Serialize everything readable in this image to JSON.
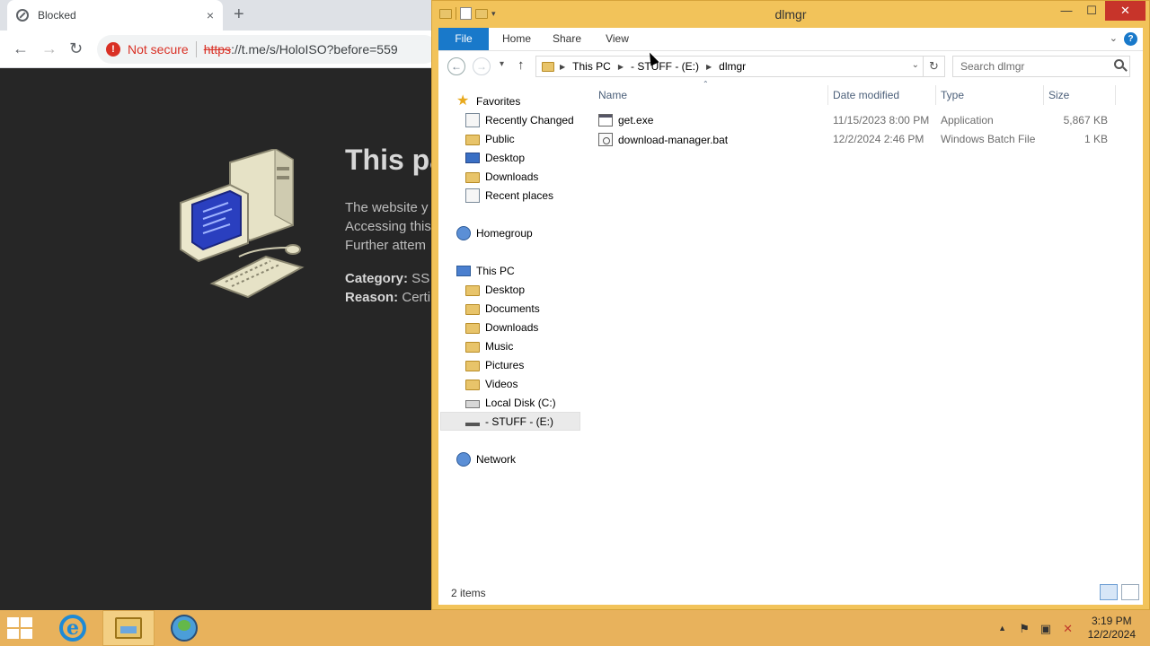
{
  "browser": {
    "tab_title": "Blocked",
    "tab_close": "×",
    "new_tab": "+",
    "nav_back": "←",
    "nav_forward": "→",
    "nav_reload": "↻",
    "security_icon": "!",
    "security_label": "Not secure",
    "url_scheme": "https",
    "url_rest": "://t.me/s/HoloISO?before=559"
  },
  "blocked_page": {
    "title": "This pa",
    "lines": [
      "The website y",
      "Accessing this",
      "Further attem"
    ],
    "category_label": "Category:",
    "category_value": " SS",
    "reason_label": "Reason:",
    "reason_value": " Certi"
  },
  "explorer": {
    "title": "dlmgr",
    "controls": {
      "minimize": "—",
      "maximize": "☐",
      "close": "✕"
    },
    "ribbon_tabs": [
      "File",
      "Home",
      "Share",
      "View"
    ],
    "ribbon_expand": "⌄",
    "help": "?",
    "address": {
      "back": "←",
      "forward": "→",
      "recent_dropdown": "▾",
      "up": "↑",
      "crumbs": [
        "This PC",
        "- STUFF - (E:)",
        "dlmgr"
      ],
      "crumb_sep": "▶",
      "dropdown": "⌄",
      "refresh": "↻",
      "search_placeholder": "Search dlmgr"
    },
    "nav": {
      "favorites": "Favorites",
      "favorites_items": [
        "Recently Changed",
        "Public",
        "Desktop",
        "Downloads",
        "Recent places"
      ],
      "homegroup": "Homegroup",
      "this_pc": "This PC",
      "pc_items": [
        "Desktop",
        "Documents",
        "Downloads",
        "Music",
        "Pictures",
        "Videos",
        "Local Disk (C:)",
        "- STUFF - (E:)"
      ],
      "network": "Network",
      "selected": "- STUFF - (E:)"
    },
    "columns": [
      "Name",
      "Date modified",
      "Type",
      "Size"
    ],
    "sort_indicator": "⌃",
    "files": [
      {
        "name": "get.exe",
        "date": "11/15/2023 8:00 PM",
        "type": "Application",
        "size": "5,867 KB",
        "icon": "exe-icon"
      },
      {
        "name": "download-manager.bat",
        "date": "12/2/2024 2:46 PM",
        "type": "Windows Batch File",
        "size": "1 KB",
        "icon": "batch-file-icon"
      }
    ],
    "status": "2 items"
  },
  "taskbar": {
    "apps": [
      "internet-explorer",
      "file-explorer",
      "browser-globe"
    ],
    "active_app": "file-explorer",
    "ie_glyph": "e",
    "tray_icons": [
      "show-hidden-icons",
      "action-center-flag",
      "network",
      "volume-muted"
    ],
    "tray_glyphs": [
      "▲",
      "⚑",
      "▣",
      "✕"
    ],
    "time": "3:19 PM",
    "date": "12/2/2024"
  },
  "colors": {
    "window_frame": "#f2c35a",
    "taskbar": "#e8b25c",
    "file_tab": "#1979ca",
    "insecure": "#d93025",
    "blocked_bg": "#262626"
  }
}
